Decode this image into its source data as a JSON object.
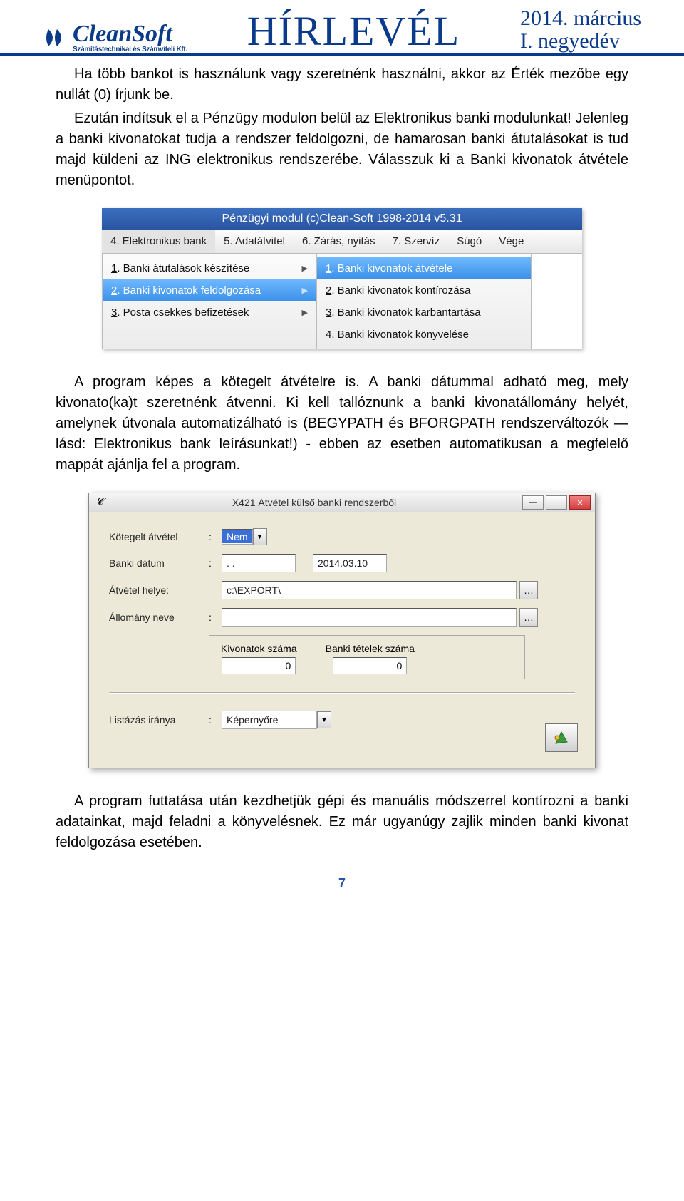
{
  "header": {
    "logo_brand": "CleanSoft",
    "logo_sub": "Számítástechnikai és Számviteli Kft.",
    "headline": "HÍRLEVÉL",
    "date_line1": "2014. március",
    "date_line2": "I. negyedév"
  },
  "para1": "Ha több bankot is használunk vagy szeretnénk használni, akkor az Érték mezőbe egy nullát (0) írjunk be.",
  "para2": "Ezután indítsuk el a Pénzügy modulon belül az Elektronikus banki modulunkat! Jelenleg a banki kivonatokat tudja a rendszer feldolgozni, de hamarosan banki átutalásokat is tud majd küldeni az ING elektronikus rendszerébe. Válasszuk ki a Banki kivonatok átvétele menüpontot.",
  "menu": {
    "title": "Pénzügyi modul (c)Clean-Soft 1998-2014 v5.31",
    "bar": [
      "4. Elektronikus bank",
      "5. Adatátvitel",
      "6. Zárás, nyitás",
      "7. Szervíz",
      "Súgó",
      "Vége"
    ],
    "col1": [
      {
        "u": "1",
        "rest": ". Banki átutalások készítése",
        "arrow": true
      },
      {
        "u": "2",
        "rest": ". Banki kivonatok feldolgozása",
        "arrow": true,
        "hl": true
      },
      {
        "u": "3",
        "rest": ". Posta csekkes befizetések",
        "arrow": true
      }
    ],
    "col2": [
      {
        "u": "1",
        "rest": ". Banki kivonatok átvétele",
        "hl": true
      },
      {
        "u": "2",
        "rest": ". Banki kivonatok kontírozása"
      },
      {
        "u": "3",
        "rest": ". Banki kivonatok karbantartása"
      },
      {
        "u": "4",
        "rest": ". Banki kivonatok könyvelése"
      }
    ]
  },
  "para3": "A program képes a kötegelt átvételre is. A banki dátummal adható meg, mely kivonato(ka)t szeretnénk átvenni. Ki kell tallóznunk a banki kivonatállomány helyét, amelynek útvonala automatizálható is (BEGYPATH és BFORGPATH rendszerváltozók — lásd: Elektronikus bank leírásunkat!) - ebben az esetben automatikusan a megfelelő mappát ajánlja fel a program.",
  "dlg": {
    "title": "X421 Átvétel külső banki rendszerből",
    "f_kotegelt_lbl": "Kötegelt átvétel",
    "f_kotegelt_val": "Nem",
    "f_datum_lbl": "Banki dátum",
    "f_datum_from": " . .",
    "f_datum_to": "2014.03.10",
    "f_hely_lbl": "Átvétel helye:",
    "f_hely_val": "c:\\EXPORT\\",
    "f_allomany_lbl": "Állomány neve",
    "f_allomany_val": "",
    "grp_kivszam_lbl": "Kivonatok száma",
    "grp_kivszam_val": "0",
    "grp_tetel_lbl": "Banki tételek száma",
    "grp_tetel_val": "0",
    "f_list_lbl": "Listázás iránya",
    "f_list_val": "Képernyőre"
  },
  "para4": "A program futtatása után kezdhetjük gépi és manuális módszerrel kontírozni a banki adatainkat, majd feladni a könyvelésnek. Ez már ugyanúgy zajlik minden banki kivonat feldolgozása esetében.",
  "page_no": "7"
}
